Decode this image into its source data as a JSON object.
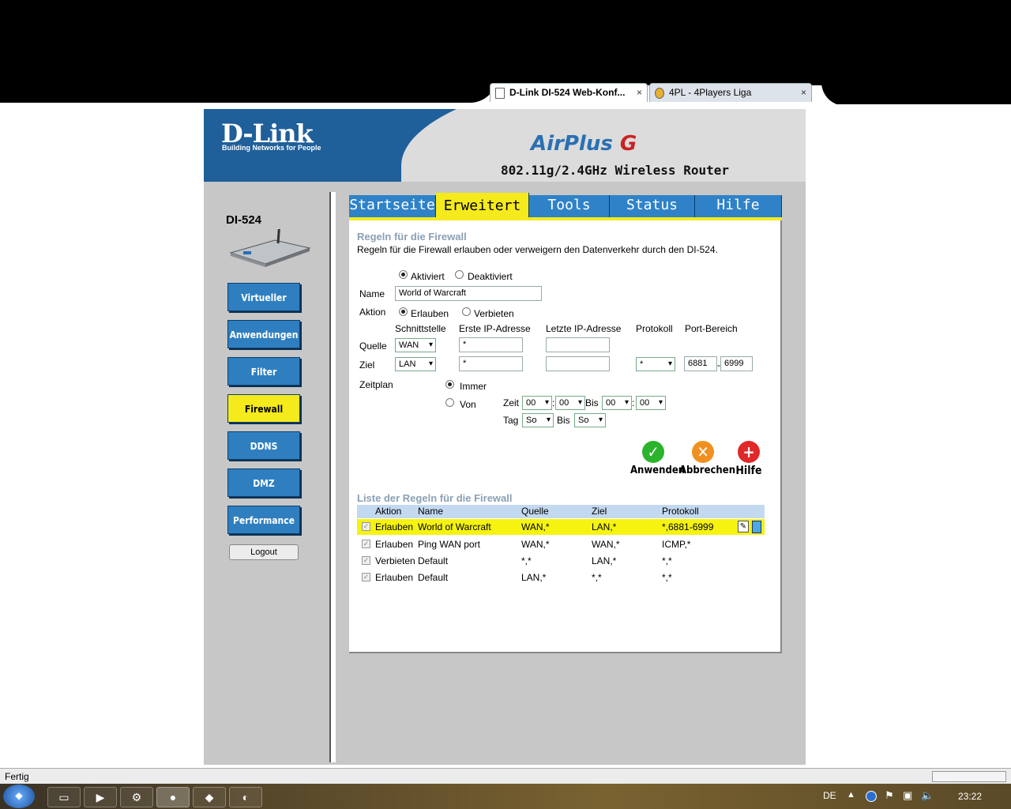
{
  "browser": {
    "tabs": [
      {
        "label": "D-Link DI-524 Web-Konf...",
        "close": "×"
      },
      {
        "label": "4PL - 4Players Liga",
        "close": "×"
      }
    ],
    "status": "Fertig"
  },
  "header": {
    "logo": "D-Link",
    "logo_tagline": "Building Networks for People",
    "product": "AirPlus",
    "product_suffix": "G",
    "router_title": "802.11g/2.4GHz Wireless Router"
  },
  "sidebar": {
    "model": "DI-524",
    "items": [
      {
        "label": "Virtueller Server"
      },
      {
        "label": "Anwendungen"
      },
      {
        "label": "Filter"
      },
      {
        "label": "Firewall",
        "active": true
      },
      {
        "label": "DDNS"
      },
      {
        "label": "DMZ"
      },
      {
        "label": "Performance"
      }
    ],
    "logout": "Logout"
  },
  "tabs": [
    {
      "label": "Startseite"
    },
    {
      "label": "Erweitert",
      "active": true
    },
    {
      "label": "Tools"
    },
    {
      "label": "Status"
    },
    {
      "label": "Hilfe"
    }
  ],
  "form": {
    "title": "Regeln für die Firewall",
    "description": "Regeln für die Firewall erlauben oder verweigern den Datenverkehr durch den DI-524.",
    "enabled_label": "Aktiviert",
    "disabled_label": "Deaktiviert",
    "name_label": "Name",
    "name_value": "World of Warcraft",
    "action_label": "Aktion",
    "allow_label": "Erlauben",
    "deny_label": "Verbieten",
    "col_interface": "Schnittstelle",
    "col_first_ip": "Erste IP-Adresse",
    "col_last_ip": "Letzte IP-Adresse",
    "col_protocol": "Protokoll",
    "col_port_range": "Port-Bereich",
    "source_label": "Quelle",
    "source_interface": "WAN",
    "source_first_ip": "*",
    "dest_label": "Ziel",
    "dest_interface": "LAN",
    "dest_first_ip": "*",
    "dest_protocol": "*",
    "port_from": "6881",
    "port_sep": "-",
    "port_to": "6999",
    "schedule_label": "Zeitplan",
    "always_label": "Immer",
    "from_label": "Von",
    "time_label": "Zeit",
    "time_h1": "00",
    "time_colon": ":",
    "time_m1": "00",
    "to_label": "Bis",
    "time_h2": "00",
    "time_m2": "00",
    "day_label": "Tag",
    "day_from": "So",
    "day_to": "So"
  },
  "actions": {
    "apply": "Anwenden",
    "cancel": "Abbrechen",
    "help": "Hilfe"
  },
  "rules": {
    "title": "Liste der Regeln für die Firewall",
    "headers": [
      "Aktion",
      "Name",
      "Quelle",
      "Ziel",
      "Protokoll"
    ],
    "rows": [
      {
        "action": "Erlauben",
        "name": "World of Warcraft",
        "source": "WAN,*",
        "dest": "LAN,*",
        "protocol": "*,6881-6999"
      },
      {
        "action": "Erlauben",
        "name": "Ping WAN port",
        "source": "WAN,*",
        "dest": "WAN,*",
        "protocol": "ICMP,*"
      },
      {
        "action": "Verbieten",
        "name": "Default",
        "source": "*,*",
        "dest": "LAN,*",
        "protocol": "*,*"
      },
      {
        "action": "Erlauben",
        "name": "Default",
        "source": "LAN,*",
        "dest": "*,*",
        "protocol": "*,*"
      }
    ]
  },
  "taskbar": {
    "lang": "DE",
    "clock": "23:22"
  }
}
